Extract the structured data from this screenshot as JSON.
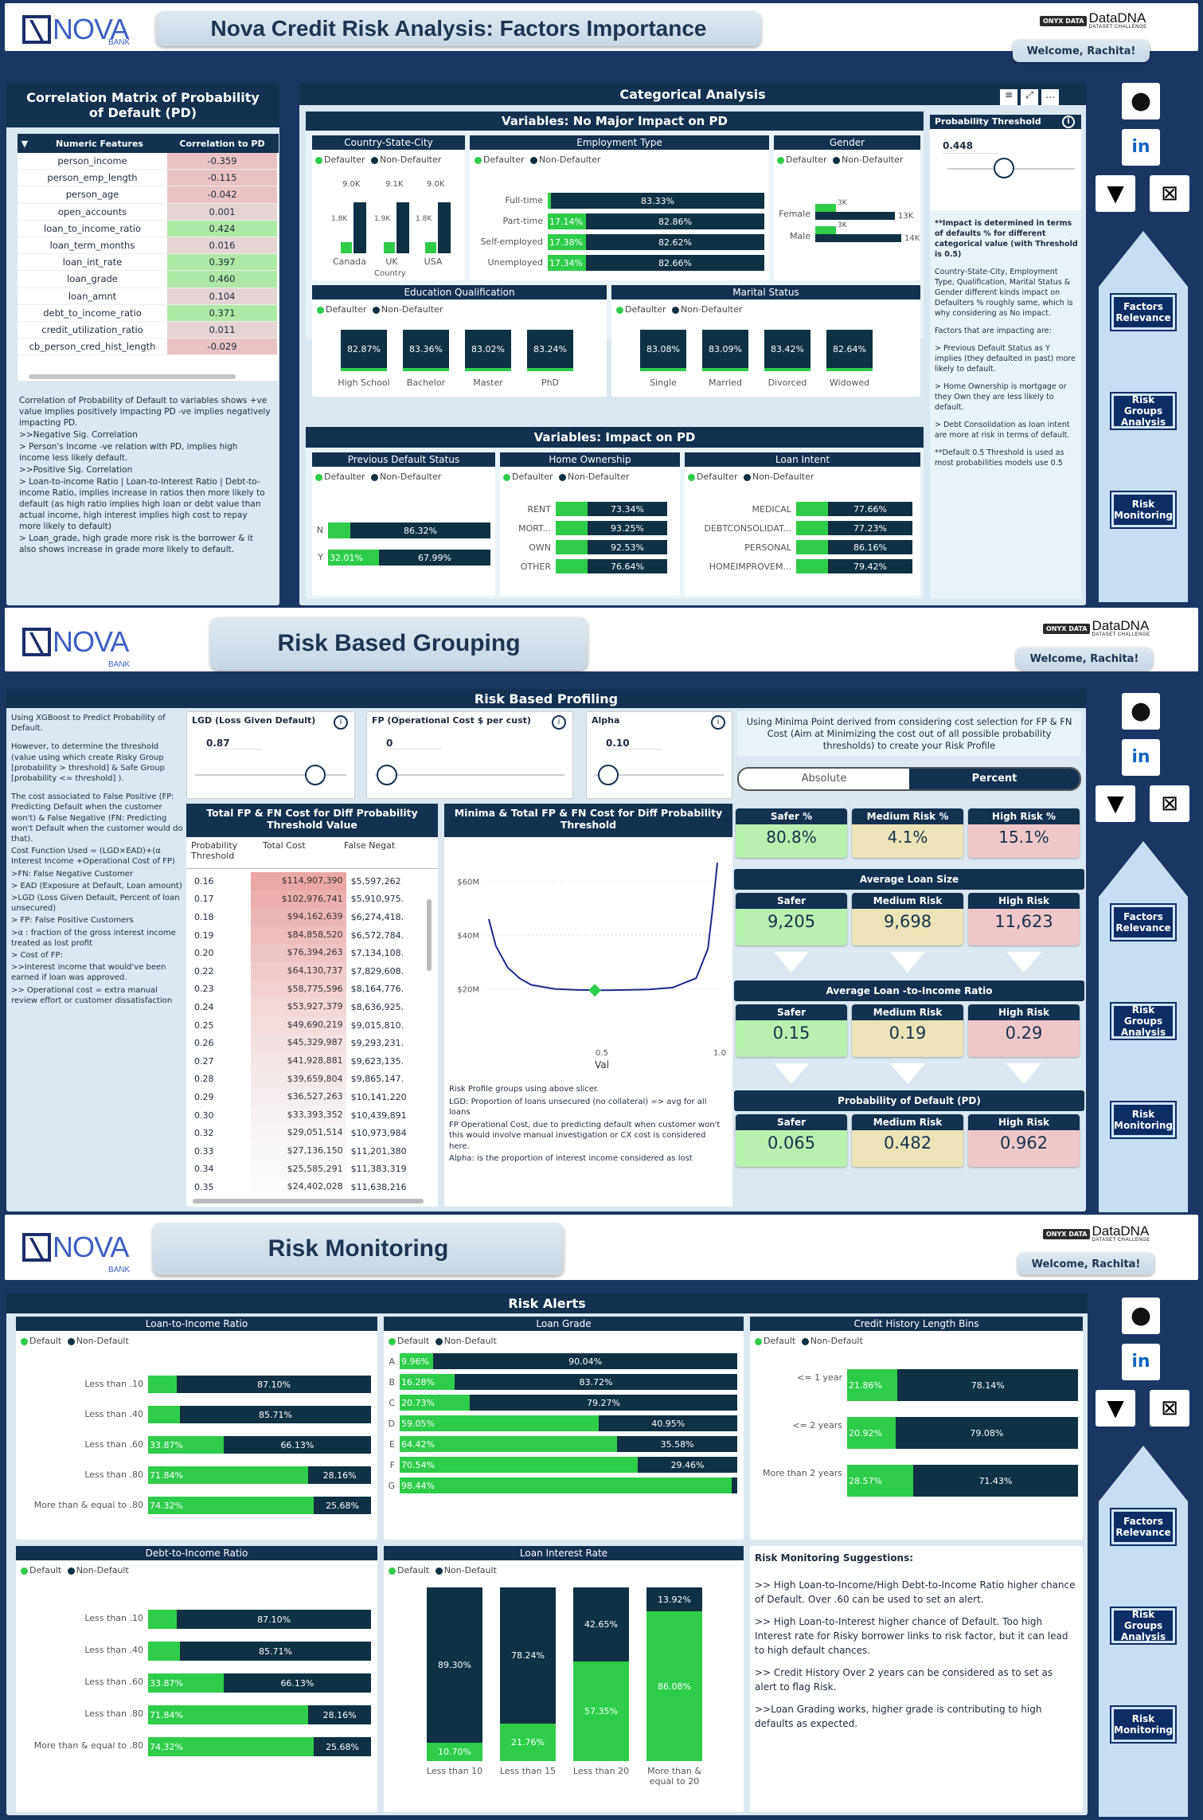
{
  "s1": {
    "logo": "NOVA",
    "logo_sub": "BANK",
    "title": "Nova Credit Risk Analysis: Factors Importance",
    "brand_onyx": "ONYX DATA",
    "brand_dna": "DataDNA",
    "brand_sub": "DATASET CHALLENGE",
    "welcome": "Welcome, Rachita!",
    "corr_title": "Correlation Matrix of Probability of Default (PD)",
    "corr_h1": "Numeric Features",
    "corr_h2": "Correlation to PD",
    "corr": [
      [
        "person_income",
        "-0.359"
      ],
      [
        "person_emp_length",
        "-0.115"
      ],
      [
        "person_age",
        "-0.042"
      ],
      [
        "open_accounts",
        "0.001"
      ],
      [
        "loan_to_income_ratio",
        "0.424"
      ],
      [
        "loan_term_months",
        "0.016"
      ],
      [
        "loan_int_rate",
        "0.397"
      ],
      [
        "loan_grade",
        "0.460"
      ],
      [
        "loan_amnt",
        "0.104"
      ],
      [
        "debt_to_income_ratio",
        "0.371"
      ],
      [
        "credit_utilization_ratio",
        "0.011"
      ],
      [
        "cb_person_cred_hist_length",
        "-0.029"
      ]
    ],
    "corr_note": [
      "Correlation of Probability of Default to variables shows +ve value implies positively impacting PD -ve implies negatively impacting PD.",
      ">>Negative Sig. Correlation",
      "> Person's Income -ve relation with PD, implies high income less likely default.",
      ">>Positive Sig. Correlation",
      "> Loan-to-income Ratio | Loan-to-Interest Ratio | Debt-to-income Ratio, implies increase in ratios then more likely to default (as high ratio implies high loan or debt value than actual income, high interest implies high cost to repay more likely to default)",
      "> Loan_grade, high grade more risk is the borrower & it also shows increase in grade more likely to default."
    ],
    "cat_title": "Categorical Analysis",
    "noimpact_title": "Variables: No Major Impact on PD",
    "impact_title": "Variables: Impact on PD",
    "leg_def": "Defaulter",
    "leg_non": "Non-Defaulter",
    "country": {
      "title": "Country-State-City",
      "cats": [
        "Canada",
        "UK",
        "USA"
      ],
      "def": [
        "1.8K",
        "1.9K",
        "1.8K"
      ],
      "non": [
        "9.0K",
        "9.1K",
        "9.0K"
      ],
      "axis": "Country"
    },
    "employment": {
      "title": "Employment Type",
      "rows": [
        [
          "Full-time",
          "",
          "83.33%"
        ],
        [
          "Part-time",
          "17.14%",
          "82.86%"
        ],
        [
          "Self-employed",
          "17.38%",
          "82.62%"
        ],
        [
          "Unemployed",
          "17.34%",
          "82.66%"
        ]
      ]
    },
    "gender": {
      "title": "Gender",
      "rows": [
        [
          "Female",
          "3K",
          "13K"
        ],
        [
          "Male",
          "3K",
          "14K"
        ]
      ]
    },
    "education": {
      "title": "Education Qualification",
      "cols": [
        [
          "82.87%",
          "High School"
        ],
        [
          "83.36%",
          "Bachelor"
        ],
        [
          "83.02%",
          "Master"
        ],
        [
          "83.24%",
          "PhD"
        ]
      ]
    },
    "marital": {
      "title": "Marital Status",
      "cols": [
        [
          "83.08%",
          "Single"
        ],
        [
          "83.09%",
          "Married"
        ],
        [
          "83.42%",
          "Divorced"
        ],
        [
          "82.64%",
          "Widowed"
        ]
      ]
    },
    "prevdef": {
      "title": "Previous Default Status",
      "rows": [
        [
          "N",
          "",
          "86.32%"
        ],
        [
          "Y",
          "32.01%",
          "67.99%"
        ]
      ]
    },
    "home": {
      "title": "Home Ownership",
      "rows": [
        [
          "RENT",
          "73.34%"
        ],
        [
          "MORT...",
          "93.25%"
        ],
        [
          "OWN",
          "92.53%"
        ],
        [
          "OTHER",
          "76.64%"
        ]
      ]
    },
    "intent": {
      "title": "Loan Intent",
      "rows": [
        [
          "MEDICAL",
          "77.66%"
        ],
        [
          "DEBTCONSOLIDAT...",
          "77.23%"
        ],
        [
          "PERSONAL",
          "86.16%"
        ],
        [
          "HOMEIMPROVEM...",
          "79.42%"
        ]
      ]
    },
    "threshold": {
      "title": "Probability Threshold",
      "value": "0.448",
      "note": [
        "**Impact is determined in terms of defaults % for different categorical value (with Threshold is 0.5)",
        "Country-State-City, Employment Type, Qualification, Marital Status & Gender different kinds impact on  Defaulters % roughly same, which is why considering as No impact.",
        "Factors that are impacting are:",
        "> Previous Default Status as Y implies (they defaulted in past) more likely to default.",
        "> Home Ownership is mortgage or they Own they are less likely to default.",
        "> Debt Consolidation as loan intent are more at risk in terms of default.",
        "**Default 0.5 Threshold is used as most probabilities models use 0.5"
      ]
    }
  },
  "nav": {
    "factors": "Factors Relevance",
    "groups": "Risk Groups Analysis",
    "monitor": "Risk Monitoring"
  },
  "s2": {
    "title": "Risk Based Grouping",
    "welcome": "Welcome, Rachita!",
    "panel_title": "Risk Based Profiling",
    "left_note": [
      "Using XGBoost to Predict Probability of Default.",
      "However, to determine the threshold (value using which create Risky Group [probability > threshold] & Safe Group [probability <= threshold] ).",
      "The cost associated to False Positive (FP: Predicting Default when the customer won't) & False Negative (FN: Predicting won't Default when the customer would do that).",
      "Cost Function Used = (LGD×EAD)+(α Interest Income +Operational Cost of FP)",
      ">FN: False Negative Customer",
      "> EAD (Exposure at Default, Loan amount)",
      ">LGD (Loss Given Default, Percent of loan unsecured)",
      "> FP: False Positive Customers",
      ">α : fraction of the gross interest income treated as lost profit",
      "> Cost of FP:",
      ">>Interest income that would've been earned if loan was approved.",
      ">> Operational cost = extra manual review effort or customer dissatisfaction"
    ],
    "lgd_title": "LGD (Loss Given Default)",
    "lgd_val": "0.87",
    "fp_title": "FP (Operational Cost $ per cust)",
    "fp_val": "0",
    "alpha_title": "Alpha",
    "alpha_val": "0.10",
    "minima_note": "Using Minima Point derived from considering cost selection for FP & FN Cost (Aim at Minimizing the cost out of all possible probability thresholds) to create your Risk Profile",
    "toggle": [
      "Absolute",
      "Percent"
    ],
    "table_title": "Total FP & FN Cost for Diff Probability Threshold Value",
    "table_h": [
      "Probability Threshold",
      "Total Cost",
      "False Negat"
    ],
    "table_rows": [
      [
        "0.16",
        "$114,907,390",
        "$5,597,262"
      ],
      [
        "0.17",
        "$102,976,741",
        "$5,910,975."
      ],
      [
        "0.18",
        "$94,162,639",
        "$6,274,418."
      ],
      [
        "0.19",
        "$84,858,520",
        "$6,572,784."
      ],
      [
        "0.20",
        "$76,394,263",
        "$7,134,108."
      ],
      [
        "0.22",
        "$64,130,737",
        "$7,829,608."
      ],
      [
        "0.23",
        "$58,775,596",
        "$8,164,776."
      ],
      [
        "0.24",
        "$53,927,379",
        "$8,636,925."
      ],
      [
        "0.25",
        "$49,690,219",
        "$9,015,810."
      ],
      [
        "0.26",
        "$45,329,987",
        "$9,293,231."
      ],
      [
        "0.27",
        "$41,928,881",
        "$9,623,135."
      ],
      [
        "0.28",
        "$39,659,804",
        "$9,865,147."
      ],
      [
        "0.29",
        "$36,527,263",
        "$10,141,220"
      ],
      [
        "0.30",
        "$33,393,352",
        "$10,439,891"
      ],
      [
        "0.32",
        "$29,051,514",
        "$10,973,984"
      ],
      [
        "0.33",
        "$27,136,150",
        "$11,201,380"
      ],
      [
        "0.34",
        "$25,585,291",
        "$11,383,319"
      ],
      [
        "0.35",
        "$24,402,028",
        "$11,638,216"
      ]
    ],
    "minima_title": "Minima & Total FP & FN Cost for Diff Probability Threshold",
    "chart_note": [
      "Risk Profile groups using above slicer.",
      "LGD: Proportion of loans unsecured (no collateral) => avg for all loans",
      "FP Operational Cost, due to predicting default when customer won't  this would involve manual investigation or CX cost is considered here.",
      "Alpha: is the proportion of interest income considered as lost"
    ],
    "kpi_labels": [
      "Safer %",
      "Medium Risk %",
      "High Risk %"
    ],
    "kpi_vals": [
      "80.8%",
      "4.1%",
      "15.1%"
    ],
    "avg_loan_title": "Average Loan Size",
    "grp": [
      "Safer",
      "Medium Risk",
      "High Risk"
    ],
    "avg_loan": [
      "9,205",
      "9,698",
      "11,623"
    ],
    "avg_lti_title": "Average Loan -to-Income Ratio",
    "avg_lti": [
      "0.15",
      "0.19",
      "0.29"
    ],
    "pd_title": "Probability of Default (PD)",
    "pd": [
      "0.065",
      "0.482",
      "0.962"
    ]
  },
  "chart_data": {
    "type": "line",
    "title": "Minima & Total FP & FN Cost for Diff Probability Threshold",
    "xlabel": "Val",
    "ylabel": "",
    "xlim": [
      0,
      1
    ],
    "ylim": [
      0,
      70
    ],
    "yticks": [
      "$20M",
      "$40M",
      "$60M"
    ],
    "xticks": [
      "0.5",
      "1.0"
    ],
    "x": [
      0.02,
      0.05,
      0.1,
      0.15,
      0.2,
      0.3,
      0.4,
      0.5,
      0.6,
      0.7,
      0.8,
      0.9,
      0.95,
      0.97,
      0.99
    ],
    "y": [
      46,
      36,
      28,
      24,
      21.5,
      20,
      19.6,
      19.5,
      19.6,
      19.8,
      20.5,
      24,
      35,
      50,
      67
    ],
    "minima": [
      0.47,
      19.5
    ]
  },
  "s3": {
    "title": "Risk Monitoring",
    "welcome": "Welcome, Rachita!",
    "panel_title": "Risk Alerts",
    "leg_def": "Default",
    "leg_non": "Non-Default",
    "lti": {
      "title": "Loan-to-Income Ratio",
      "rows": [
        [
          "Less than .10",
          "",
          "87.10%",
          12.9
        ],
        [
          "Less than .40",
          "",
          "85.71%",
          14.3
        ],
        [
          "Less than .60",
          "33.87%",
          "66.13%",
          33.87
        ],
        [
          "Less than .80",
          "71.84%",
          "28.16%",
          71.84
        ],
        [
          "More than & equal to .80",
          "74.32%",
          "25.68%",
          74.32
        ]
      ]
    },
    "grade": {
      "title": "Loan Grade",
      "rows": [
        [
          "A",
          "9.96%",
          "90.04%",
          9.96
        ],
        [
          "B",
          "16.28%",
          "83.72%",
          16.28
        ],
        [
          "C",
          "20.73%",
          "79.27%",
          20.73
        ],
        [
          "D",
          "59.05%",
          "40.95%",
          59.05
        ],
        [
          "E",
          "64.42%",
          "35.58%",
          64.42
        ],
        [
          "F",
          "70.54%",
          "29.46%",
          70.54
        ],
        [
          "G",
          "98.44%",
          "",
          98.44
        ]
      ]
    },
    "hist": {
      "title": "Credit History Length Bins",
      "rows": [
        [
          "<= 1 year",
          "21.86%",
          "78.14%",
          21.86
        ],
        [
          "<= 2 years",
          "20.92%",
          "79.08%",
          20.92
        ],
        [
          "More than 2 years",
          "28.57%",
          "71.43%",
          28.57
        ]
      ]
    },
    "dti": {
      "title": "Debt-to-Income Ratio",
      "rows": [
        [
          "Less than .10",
          "",
          "87.10%",
          12.9
        ],
        [
          "Less than .40",
          "",
          "85.71%",
          14.3
        ],
        [
          "Less than .60",
          "33.87%",
          "66.13%",
          33.87
        ],
        [
          "Less than .80",
          "71.84%",
          "28.16%",
          71.84
        ],
        [
          "More than & equal to .80",
          "74.32%",
          "25.68%",
          74.32
        ]
      ]
    },
    "rate": {
      "title": "Loan Interest Rate",
      "cols": [
        [
          "Less than 10",
          "10.70%",
          "89.30%",
          10.7
        ],
        [
          "Less than 15",
          "21.76%",
          "78.24%",
          21.76
        ],
        [
          "Less than 20",
          "57.35%",
          "42.65%",
          57.35
        ],
        [
          "More than & equal to 20",
          "86.08%",
          "13.92%",
          86.08
        ]
      ]
    },
    "sugg_title": "Risk Monitoring Suggestions:",
    "sugg": [
      ">> High Loan-to-Income/High Debt-to-Income Ratio higher chance of Default. Over .60 can be used to set an alert.",
      ">> High Loan-to-Interest higher chance of Default. Too high Interest rate for Risky borrower links to risk factor, but it can lead to high default chances.",
      ">> Credit History Over 2 years can be considered as to set as alert to flag Risk.",
      ">>Loan Grading works, higher grade is contributing to high defaults as expected."
    ]
  },
  "colors": {
    "navy": "#14314f",
    "green": "#2fcc4a",
    "dark": "#0f3143",
    "bg": "#1b3565"
  }
}
